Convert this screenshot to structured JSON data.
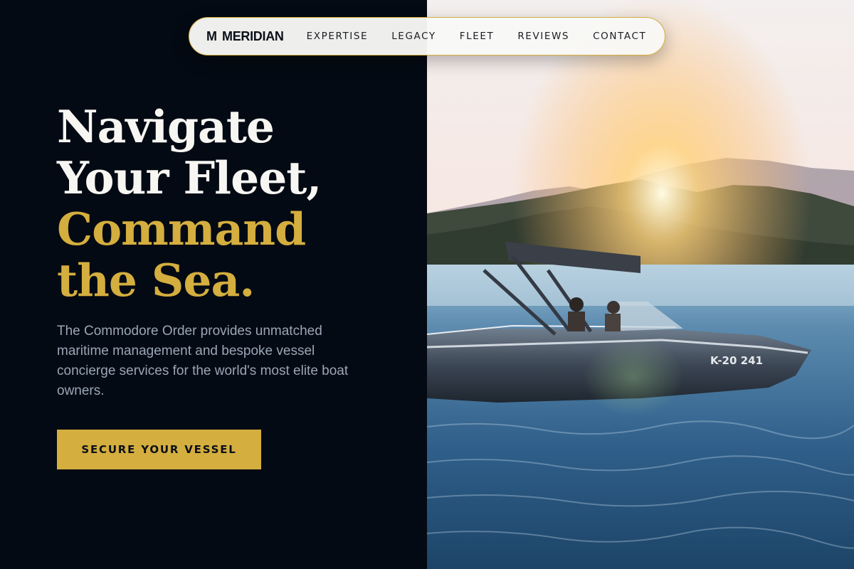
{
  "nav": {
    "logo_mark": "M",
    "brand": "MERIDIAN",
    "links": [
      {
        "label": "EXPERTISE"
      },
      {
        "label": "LEGACY"
      },
      {
        "label": "FLEET"
      },
      {
        "label": "REVIEWS"
      },
      {
        "label": "CONTACT"
      }
    ]
  },
  "hero": {
    "headline_lines": [
      "Navigate",
      "Your Fleet,",
      "Command",
      "the Sea."
    ],
    "description": "The Commodore Order provides unmatched maritime management and bespoke vessel concierge services for the world's most elite boat owners.",
    "cta_label": "SECURE YOUR VESSEL",
    "boat_registration": "K-20 241"
  },
  "colors": {
    "background": "#040a13",
    "accent_gold": "#d4ae3e",
    "headline_white": "#f7f6f2",
    "body_text": "#9aa6b6",
    "nav_background": "#f8f8f6"
  }
}
